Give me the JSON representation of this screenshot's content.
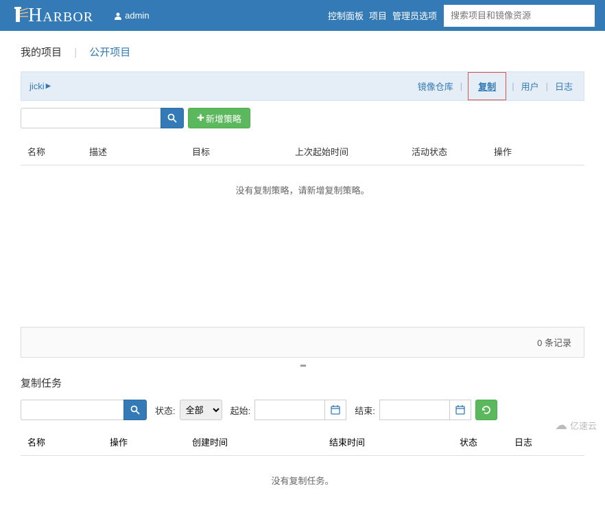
{
  "header": {
    "logo_text": "ARBOR",
    "username": "admin",
    "nav": {
      "dashboard": "控制面板",
      "project": "项目",
      "admin": "管理员选项"
    },
    "search_placeholder": "搜索项目和镜像资源"
  },
  "project_tabs": {
    "mine": "我的项目",
    "public": "公开项目"
  },
  "breadcrumb": {
    "project_name": "jicki",
    "tabs": {
      "repos": "镜像仓库",
      "replication": "复制",
      "users": "用户",
      "logs": "日志"
    }
  },
  "toolbar": {
    "add_policy": "新增策略"
  },
  "policy_table": {
    "headers": {
      "name": "名称",
      "desc": "描述",
      "target": "目标",
      "last": "上次起始时间",
      "status": "活动状态",
      "op": "操作"
    },
    "empty": "没有复制策略，请新增复制策略。"
  },
  "records": {
    "count": 0,
    "unit": "条记录"
  },
  "tasks": {
    "title": "复制任务",
    "status_label": "状态:",
    "status_options": [
      "全部"
    ],
    "status_selected": "全部",
    "start_label": "起始:",
    "end_label": "结束:",
    "headers": {
      "name": "名称",
      "op": "操作",
      "create": "创建时间",
      "end": "结束时间",
      "status": "状态",
      "log": "日志"
    },
    "empty": "没有复制任务。"
  },
  "watermark": "亿速云"
}
